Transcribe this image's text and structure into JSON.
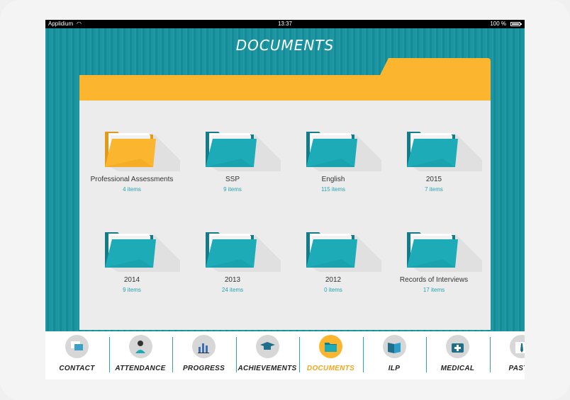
{
  "status_bar": {
    "carrier": "Applidium",
    "time": "13:37",
    "battery": "100 %"
  },
  "page": {
    "title": "DOCUMENTS"
  },
  "colors": {
    "teal": "#15929e",
    "folder_teal": "#1eabb8",
    "accent": "#fbb52f",
    "count_text": "#25a3b4"
  },
  "folders": [
    {
      "name": "Professional Assessments",
      "count": "4 items",
      "color": "yellow"
    },
    {
      "name": "SSP",
      "count": "9 items",
      "color": "teal"
    },
    {
      "name": "English",
      "count": "115 items",
      "color": "teal"
    },
    {
      "name": "2015",
      "count": "7 items",
      "color": "teal"
    },
    {
      "name": "2014",
      "count": "9 items",
      "color": "teal"
    },
    {
      "name": "2013",
      "count": "24 items",
      "color": "teal"
    },
    {
      "name": "2012",
      "count": "0 items",
      "color": "teal"
    },
    {
      "name": "Records of Interviews",
      "count": "17 items",
      "color": "teal"
    }
  ],
  "tabs": [
    {
      "label": "CONTACT",
      "icon": "chat-icon"
    },
    {
      "label": "ATTENDANCE",
      "icon": "person-check-icon"
    },
    {
      "label": "PROGRESS",
      "icon": "bar-chart-icon"
    },
    {
      "label": "ACHIEVEMENTS",
      "icon": "graduation-cap-icon"
    },
    {
      "label": "DOCUMENTS",
      "icon": "folder-icon",
      "active": true
    },
    {
      "label": "ILP",
      "icon": "book-icon"
    },
    {
      "label": "MEDICAL",
      "icon": "medical-kit-icon"
    },
    {
      "label": "PASTO",
      "icon": "tie-icon"
    }
  ]
}
